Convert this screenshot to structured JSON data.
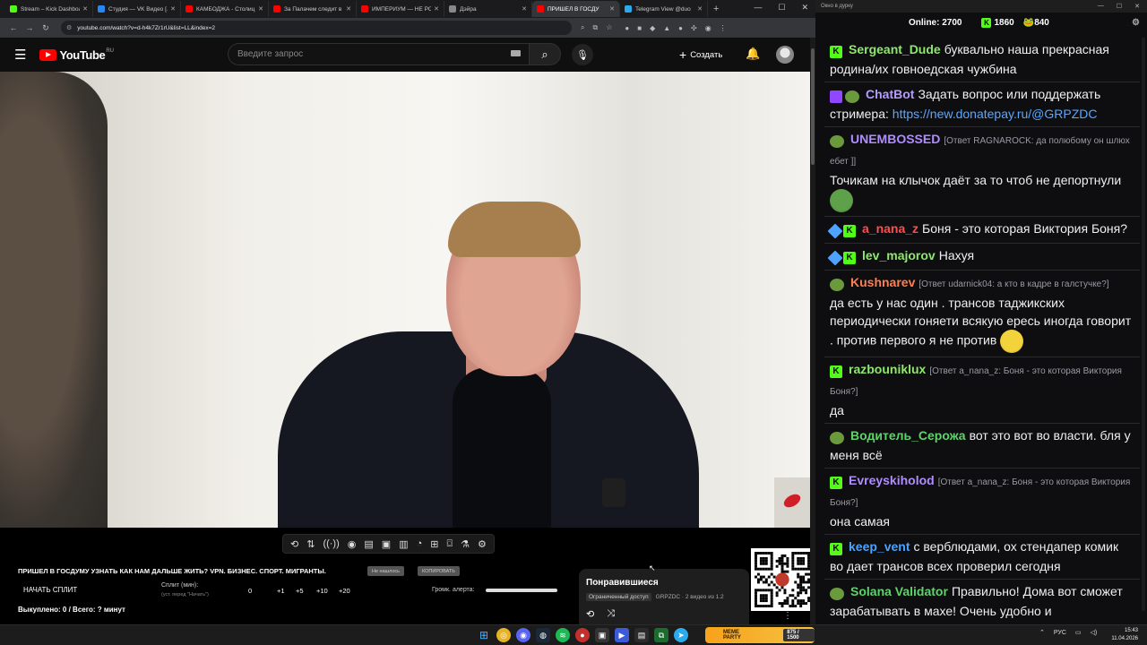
{
  "browser": {
    "tabs": [
      {
        "title": "Stream – Kick Dashboa",
        "color": "#53fc18",
        "active": false
      },
      {
        "title": "Студия — VK Видео [...]",
        "color": "#2787f5",
        "active": false
      },
      {
        "title": "КАМБОДЖА - Столиц",
        "color": "#ff0000",
        "active": false
      },
      {
        "title": "За Палачем следит в р",
        "color": "#ff0000",
        "active": false
      },
      {
        "title": "ИМПЕРИУМ — НЕ РО",
        "color": "#ff0000",
        "active": false
      },
      {
        "title": "Дэйра",
        "color": "#888888",
        "active": false
      },
      {
        "title": "ПРИШЕЛ В ГОСДУ",
        "color": "#ff0000",
        "active": true
      },
      {
        "title": "Telegram View @duo",
        "color": "#2aabee",
        "active": false
      }
    ],
    "url": "youtube.com/watch?v=d-h4k7Zr1rU&list=LL&index=2"
  },
  "youtube": {
    "logo_word": "YouTube",
    "region": "RU",
    "search_placeholder": "Введите запрос",
    "create_label": "Создать"
  },
  "overlay": {
    "title": "ПРИШЕЛ В ГОСДУМУ УЗНАТЬ КАК НАМ ДАЛЬШЕ ЖИТЬ? VPN. БИЗНЕС. СПОРТ. МИГРАНТЫ.",
    "chip1": "Не нашлось",
    "chip2": "КОПИРОВАТЬ",
    "split_button": "НАЧАТЬ СПЛИТ",
    "split_label": "Сплит (мин):",
    "split_hint": "(уст. перед \"Начать\")",
    "split_values": [
      "0",
      "+1",
      "+5",
      "+10",
      "+20"
    ],
    "alert_label": "Громк. алерта:",
    "alert_volume": 1.0,
    "bought": "Выкуплено: 0 / Всего: ? минут"
  },
  "liked": {
    "title": "Понравившиеся",
    "badge": "Ограниченный доступ",
    "meta": "GRPZDC · 2 видео из 1.2"
  },
  "chat": {
    "window_title": "Окно в дурку",
    "online_label": "Online:",
    "online_count": "2700",
    "kick_count": "1860",
    "other_count": "840",
    "messages": [
      {
        "badges": [
          "kick"
        ],
        "user": "Sergeant_Dude",
        "color": "#8ee86b",
        "reply": "",
        "text": "буквально наша прекрасная родина/их говноедская чужбина",
        "emote": ""
      },
      {
        "badges": [
          "bot",
          "frog"
        ],
        "user": "ChatBot",
        "color": "#b59cff",
        "reply": "",
        "text": "Задать вопрос или поддержать стримера: ",
        "link": "https://new.donatepay.ru/@GRPZDC",
        "emote": ""
      },
      {
        "badges": [
          "frog"
        ],
        "user": "UNEMBOSSED",
        "color": "#b08cff",
        "reply": "[Ответ RAGNAROCK: да полюбому он шлюх ебет ]]",
        "text": "Точикам на клычок даёт за то чтоб не депортнули",
        "emote": "pepe"
      },
      {
        "badges": [
          "sword",
          "kick"
        ],
        "user": "a_nana_z",
        "color": "#ff4d4d",
        "reply": "",
        "text": "Боня - это которая Виктория Боня?",
        "emote": ""
      },
      {
        "badges": [
          "sword",
          "kick"
        ],
        "user": "lev_majorov",
        "color": "#8ee86b",
        "reply": "",
        "text": "Нахуя",
        "emote": ""
      },
      {
        "badges": [
          "frog"
        ],
        "user": "Kushnarev",
        "color": "#ff7f50",
        "reply": "[Ответ udarnick04: а кто в кадре в галстучке?]",
        "text": "да есть у нас один . трансов таджикских периодически гоняети всякую ересь иногда говорит . против первого я не против",
        "emote": "laugh"
      },
      {
        "badges": [
          "kick"
        ],
        "user": "razbouniklux",
        "color": "#8ee86b",
        "reply": "[Ответ a_nana_z: Боня - это которая Виктория Боня?]",
        "text": "да",
        "emote": ""
      },
      {
        "badges": [
          "frog"
        ],
        "user": "Водитель_Серожа",
        "color": "#5fd36b",
        "reply": "",
        "text": "вот это вот во власти. бля у меня всё",
        "emote": ""
      },
      {
        "badges": [
          "kick"
        ],
        "user": "Evreyskiholod",
        "color": "#b08cff",
        "reply": "[Ответ a_nana_z: Боня - это которая Виктория Боня?]",
        "text": "она самая",
        "emote": ""
      },
      {
        "badges": [
          "kick"
        ],
        "user": "keep_vent",
        "color": "#4aa3ff",
        "reply": "",
        "text": "с верблюдами, ох стендапер комик во дает трансов всех проверил сегодня",
        "emote": ""
      },
      {
        "badges": [
          "frog"
        ],
        "user": "Solana Validator",
        "color": "#5fd36b",
        "reply": "",
        "text": "Правильно! Дома вот сможет зарабатывать в махе! Очень удобно и прогрессивно, точно вернутся все инфлюенсеры",
        "emote": ""
      }
    ]
  },
  "taskbar": {
    "meme_title": "MEME PARTY",
    "meme_score": "875 / 1500",
    "lang": "РУС",
    "time": "15:43",
    "date": "11.04.2026"
  }
}
